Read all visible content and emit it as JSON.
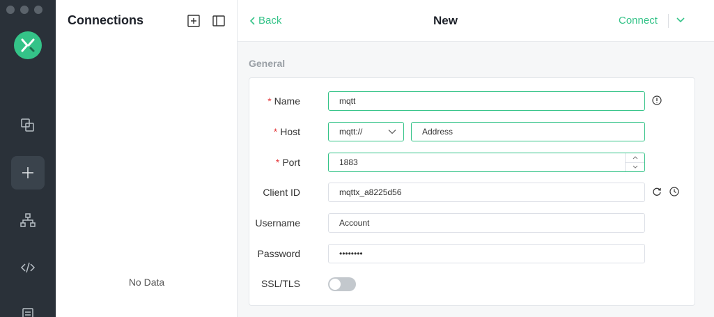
{
  "rail": {
    "items": [
      {
        "name": "connections",
        "icon": "copy-icon"
      },
      {
        "name": "new",
        "icon": "plus-icon"
      },
      {
        "name": "scripts",
        "icon": "sitemap-icon"
      },
      {
        "name": "code",
        "icon": "code-icon"
      },
      {
        "name": "log",
        "icon": "log-icon"
      }
    ],
    "active": "new"
  },
  "connections": {
    "title": "Connections",
    "empty_text": "No Data"
  },
  "header": {
    "back_label": "Back",
    "title": "New",
    "connect_label": "Connect"
  },
  "form": {
    "section": "General",
    "name": {
      "label": "Name",
      "value": "mqtt"
    },
    "host": {
      "label": "Host",
      "protocol": "mqtt://",
      "placeholder": "Address"
    },
    "port": {
      "label": "Port",
      "value": "1883"
    },
    "client_id": {
      "label": "Client ID",
      "value": "mqttx_a8225d56"
    },
    "username": {
      "label": "Username",
      "placeholder": "Account"
    },
    "password": {
      "label": "Password",
      "value": "••••••••"
    },
    "ssl": {
      "label": "SSL/TLS",
      "enabled": false
    },
    "required_mark": "*"
  },
  "colors": {
    "accent": "#34c388",
    "rail_bg": "#2a3139",
    "required": "#e4393c"
  }
}
